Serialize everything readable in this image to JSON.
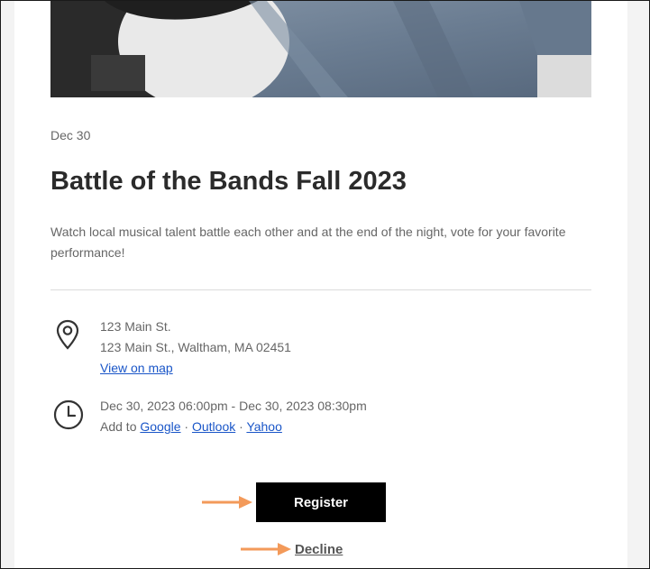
{
  "event": {
    "date_short": "Dec 30",
    "title": "Battle of the Bands Fall 2023",
    "description": "Watch local musical talent battle each other and at the end of the night, vote for your favorite performance!"
  },
  "location": {
    "name": "123 Main St.",
    "address": "123 Main St., Waltham, MA 02451",
    "map_link": "View on map",
    "icon": "map-pin-icon"
  },
  "time": {
    "range": "Dec 30, 2023 06:00pm - Dec 30, 2023 08:30pm",
    "add_to_label": "Add to",
    "calendars": [
      "Google",
      "Outlook",
      "Yahoo"
    ],
    "separator": "·",
    "icon": "clock-icon"
  },
  "actions": {
    "register_label": "Register",
    "decline_label": "Decline"
  },
  "colors": {
    "arrow": "#f39a5a",
    "link": "#1a56c8",
    "button_bg": "#000000"
  }
}
